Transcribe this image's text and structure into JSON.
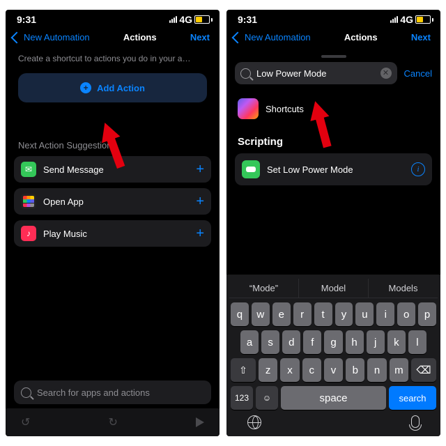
{
  "status": {
    "time": "9:31",
    "network": "4G"
  },
  "nav": {
    "back": "New Automation",
    "title": "Actions",
    "next": "Next"
  },
  "left": {
    "hint": "Create a shortcut to actions you do in your a…",
    "addAction": "Add Action",
    "sectionLabel": "Next Action Suggestions",
    "suggestions": [
      {
        "label": "Send Message"
      },
      {
        "label": "Open App"
      },
      {
        "label": "Play Music"
      }
    ],
    "searchPlaceholder": "Search for apps and actions"
  },
  "right": {
    "searchValue": "Low Power Mode",
    "cancel": "Cancel",
    "appRow": "Shortcuts",
    "sectionHeader": "Scripting",
    "actionLabel": "Set Low Power Mode"
  },
  "keyboard": {
    "predictions": [
      "“Mode”",
      "Model",
      "Models"
    ],
    "row1": [
      "q",
      "w",
      "e",
      "r",
      "t",
      "y",
      "u",
      "i",
      "o",
      "p"
    ],
    "row2": [
      "a",
      "s",
      "d",
      "f",
      "g",
      "h",
      "j",
      "k",
      "l"
    ],
    "row3": [
      "z",
      "x",
      "c",
      "v",
      "b",
      "n",
      "m"
    ],
    "numKey": "123",
    "space": "space",
    "search": "search"
  }
}
